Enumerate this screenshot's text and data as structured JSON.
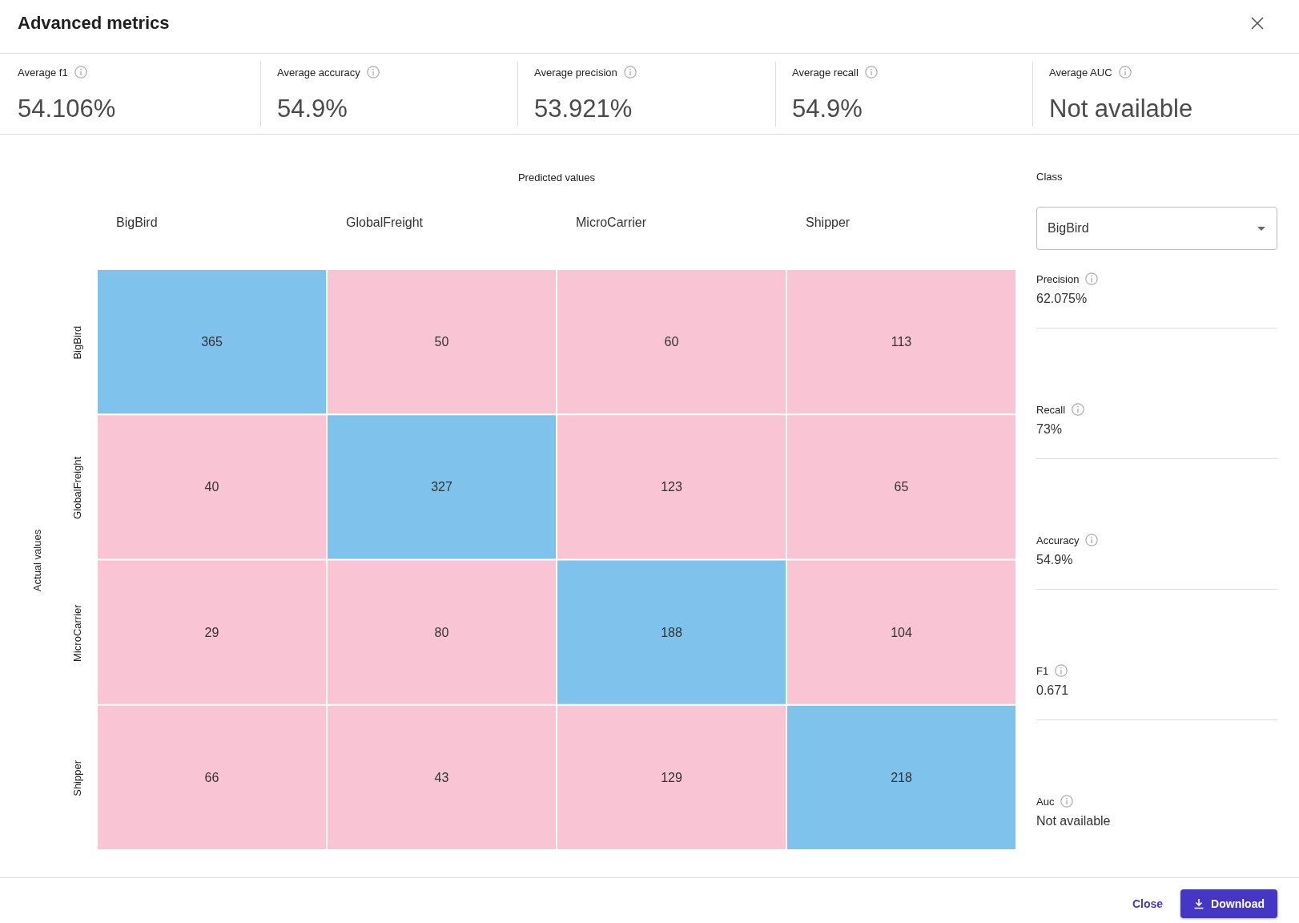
{
  "dialog": {
    "title": "Advanced metrics"
  },
  "summary_metrics": [
    {
      "label": "Average f1",
      "value": "54.106%"
    },
    {
      "label": "Average accuracy",
      "value": "54.9%"
    },
    {
      "label": "Average precision",
      "value": "53.921%"
    },
    {
      "label": "Average recall",
      "value": "54.9%"
    },
    {
      "label": "Average AUC",
      "value": "Not available"
    }
  ],
  "confusion_matrix": {
    "chart_data": {
      "type": "heatmap",
      "xlabel": "Predicted values",
      "ylabel": "Actual values",
      "categories": [
        "BigBird",
        "GlobalFreight",
        "MicroCarrier",
        "Shipper"
      ],
      "y_categories": [
        "BigBird",
        "GlobalFreight",
        "MicroCarrier",
        "Shipper"
      ],
      "cells": [
        [
          365,
          50,
          60,
          113
        ],
        [
          40,
          327,
          123,
          65
        ],
        [
          29,
          80,
          188,
          104
        ],
        [
          66,
          43,
          129,
          218
        ]
      ],
      "data_labels": true,
      "colors": [
        "#7fc3ec",
        "#f9c5d5"
      ]
    }
  },
  "class_panel": {
    "label": "Class",
    "select": {
      "value": "BigBird"
    },
    "metrics": [
      {
        "label": "Precision",
        "value": "62.075%"
      },
      {
        "label": "Recall",
        "value": "73%"
      },
      {
        "label": "Accuracy",
        "value": "54.9%"
      },
      {
        "label": "F1",
        "value": "0.671"
      },
      {
        "label": "Auc",
        "value": "Not available"
      }
    ]
  },
  "footer": {
    "buttons": [
      {
        "label": "Close",
        "kind": "text"
      },
      {
        "label": "Download",
        "kind": "primary"
      }
    ]
  }
}
